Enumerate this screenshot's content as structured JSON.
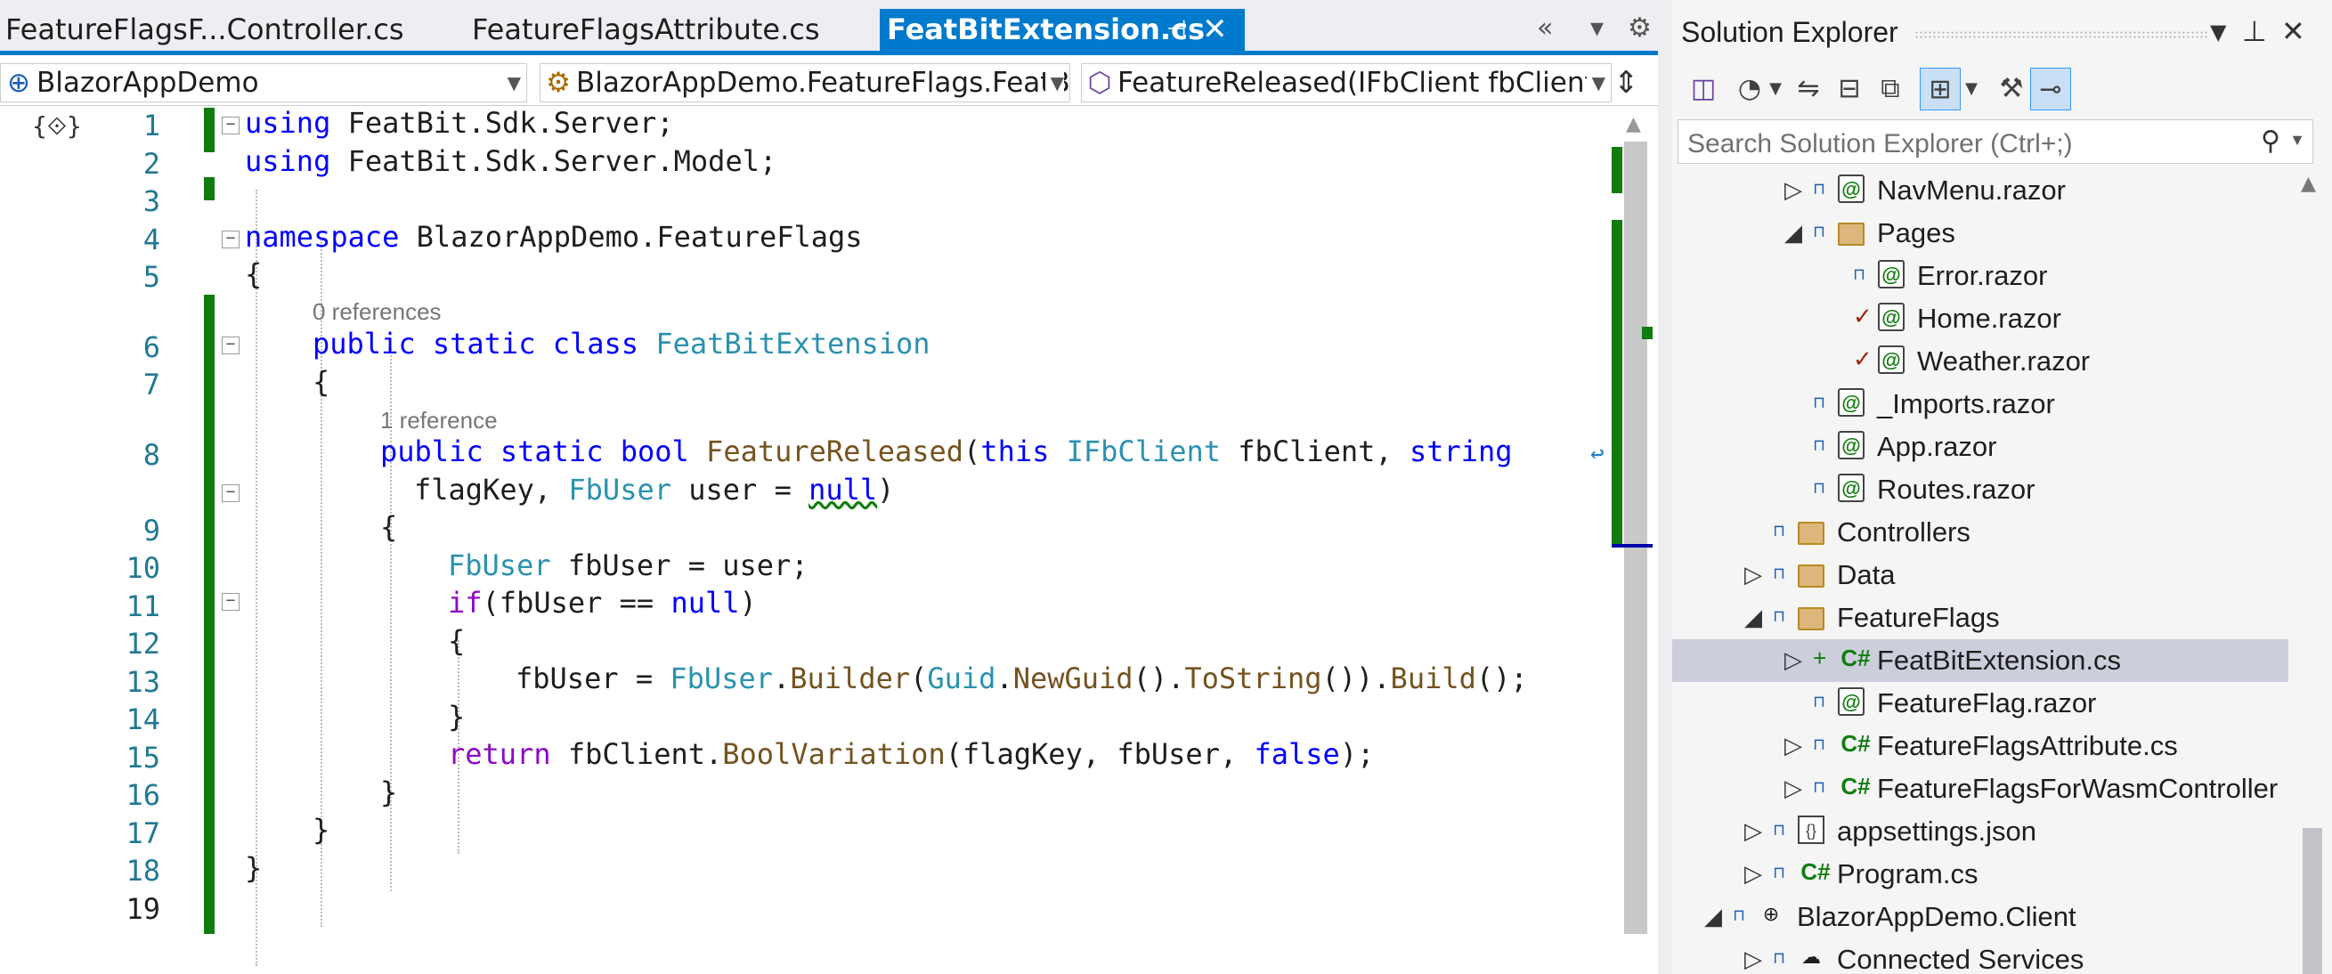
{
  "editor": {
    "tabs": [
      {
        "label": "FeatureFlagsF...Controller.cs",
        "active": false
      },
      {
        "label": "FeatureFlagsAttribute.cs",
        "active": false
      },
      {
        "label": "FeatBitExtension.cs",
        "active": true
      }
    ],
    "tab_tools": {
      "overflow": "«",
      "list": "▾",
      "settings": "⚙"
    },
    "nav": {
      "project": "BlazorAppDemo",
      "type": "BlazorAppDemo.FeatureFlags.FeatB",
      "member": "FeatureReleased(IFbClient fbClient, s"
    },
    "line_numbers": [
      "1",
      "2",
      "3",
      "4",
      "5",
      "6",
      "7",
      "8",
      "9",
      "10",
      "11",
      "12",
      "13",
      "14",
      "15",
      "16",
      "17",
      "18",
      "19"
    ],
    "codelens": {
      "class_refs": "0 references",
      "method_refs": "1 reference"
    },
    "current_line": "19"
  },
  "solution_explorer": {
    "title": "Solution Explorer",
    "search_placeholder": "Search Solution Explorer (Ctrl+;)",
    "items": [
      {
        "label": "NavMenu.razor",
        "type": "razor",
        "expander": "collapsed"
      },
      {
        "label": "Pages",
        "type": "folder",
        "expander": "expanded"
      },
      {
        "label": "Error.razor",
        "type": "razor",
        "expander": "none"
      },
      {
        "label": "Home.razor",
        "type": "razor",
        "expander": "none",
        "status": "checked-out"
      },
      {
        "label": "Weather.razor",
        "type": "razor",
        "expander": "none",
        "status": "checked-out"
      },
      {
        "label": "_Imports.razor",
        "type": "razor",
        "expander": "none"
      },
      {
        "label": "App.razor",
        "type": "razor",
        "expander": "none"
      },
      {
        "label": "Routes.razor",
        "type": "razor",
        "expander": "none"
      },
      {
        "label": "Controllers",
        "type": "folder",
        "expander": "none"
      },
      {
        "label": "Data",
        "type": "folder",
        "expander": "collapsed"
      },
      {
        "label": "FeatureFlags",
        "type": "folder",
        "expander": "expanded"
      },
      {
        "label": "FeatBitExtension.cs",
        "type": "cs",
        "expander": "collapsed",
        "selected": true,
        "status": "added"
      },
      {
        "label": "FeatureFlag.razor",
        "type": "razor",
        "expander": "none"
      },
      {
        "label": "FeatureFlagsAttribute.cs",
        "type": "cs",
        "expander": "collapsed"
      },
      {
        "label": "FeatureFlagsForWasmController",
        "type": "cs",
        "expander": "collapsed"
      },
      {
        "label": "appsettings.json",
        "type": "json",
        "expander": "collapsed"
      },
      {
        "label": "Program.cs",
        "type": "cs",
        "expander": "collapsed"
      },
      {
        "label": "BlazorAppDemo.Client",
        "type": "project",
        "expander": "expanded"
      },
      {
        "label": "Connected Services",
        "type": "service",
        "expander": "collapsed"
      }
    ]
  },
  "colors": {
    "accent": "#007acc",
    "keyword": "#0000ff",
    "type": "#2b91af",
    "method": "#74531f",
    "control": "#8f08c4",
    "change_bar": "#107c10",
    "selection": "#cccedb"
  }
}
